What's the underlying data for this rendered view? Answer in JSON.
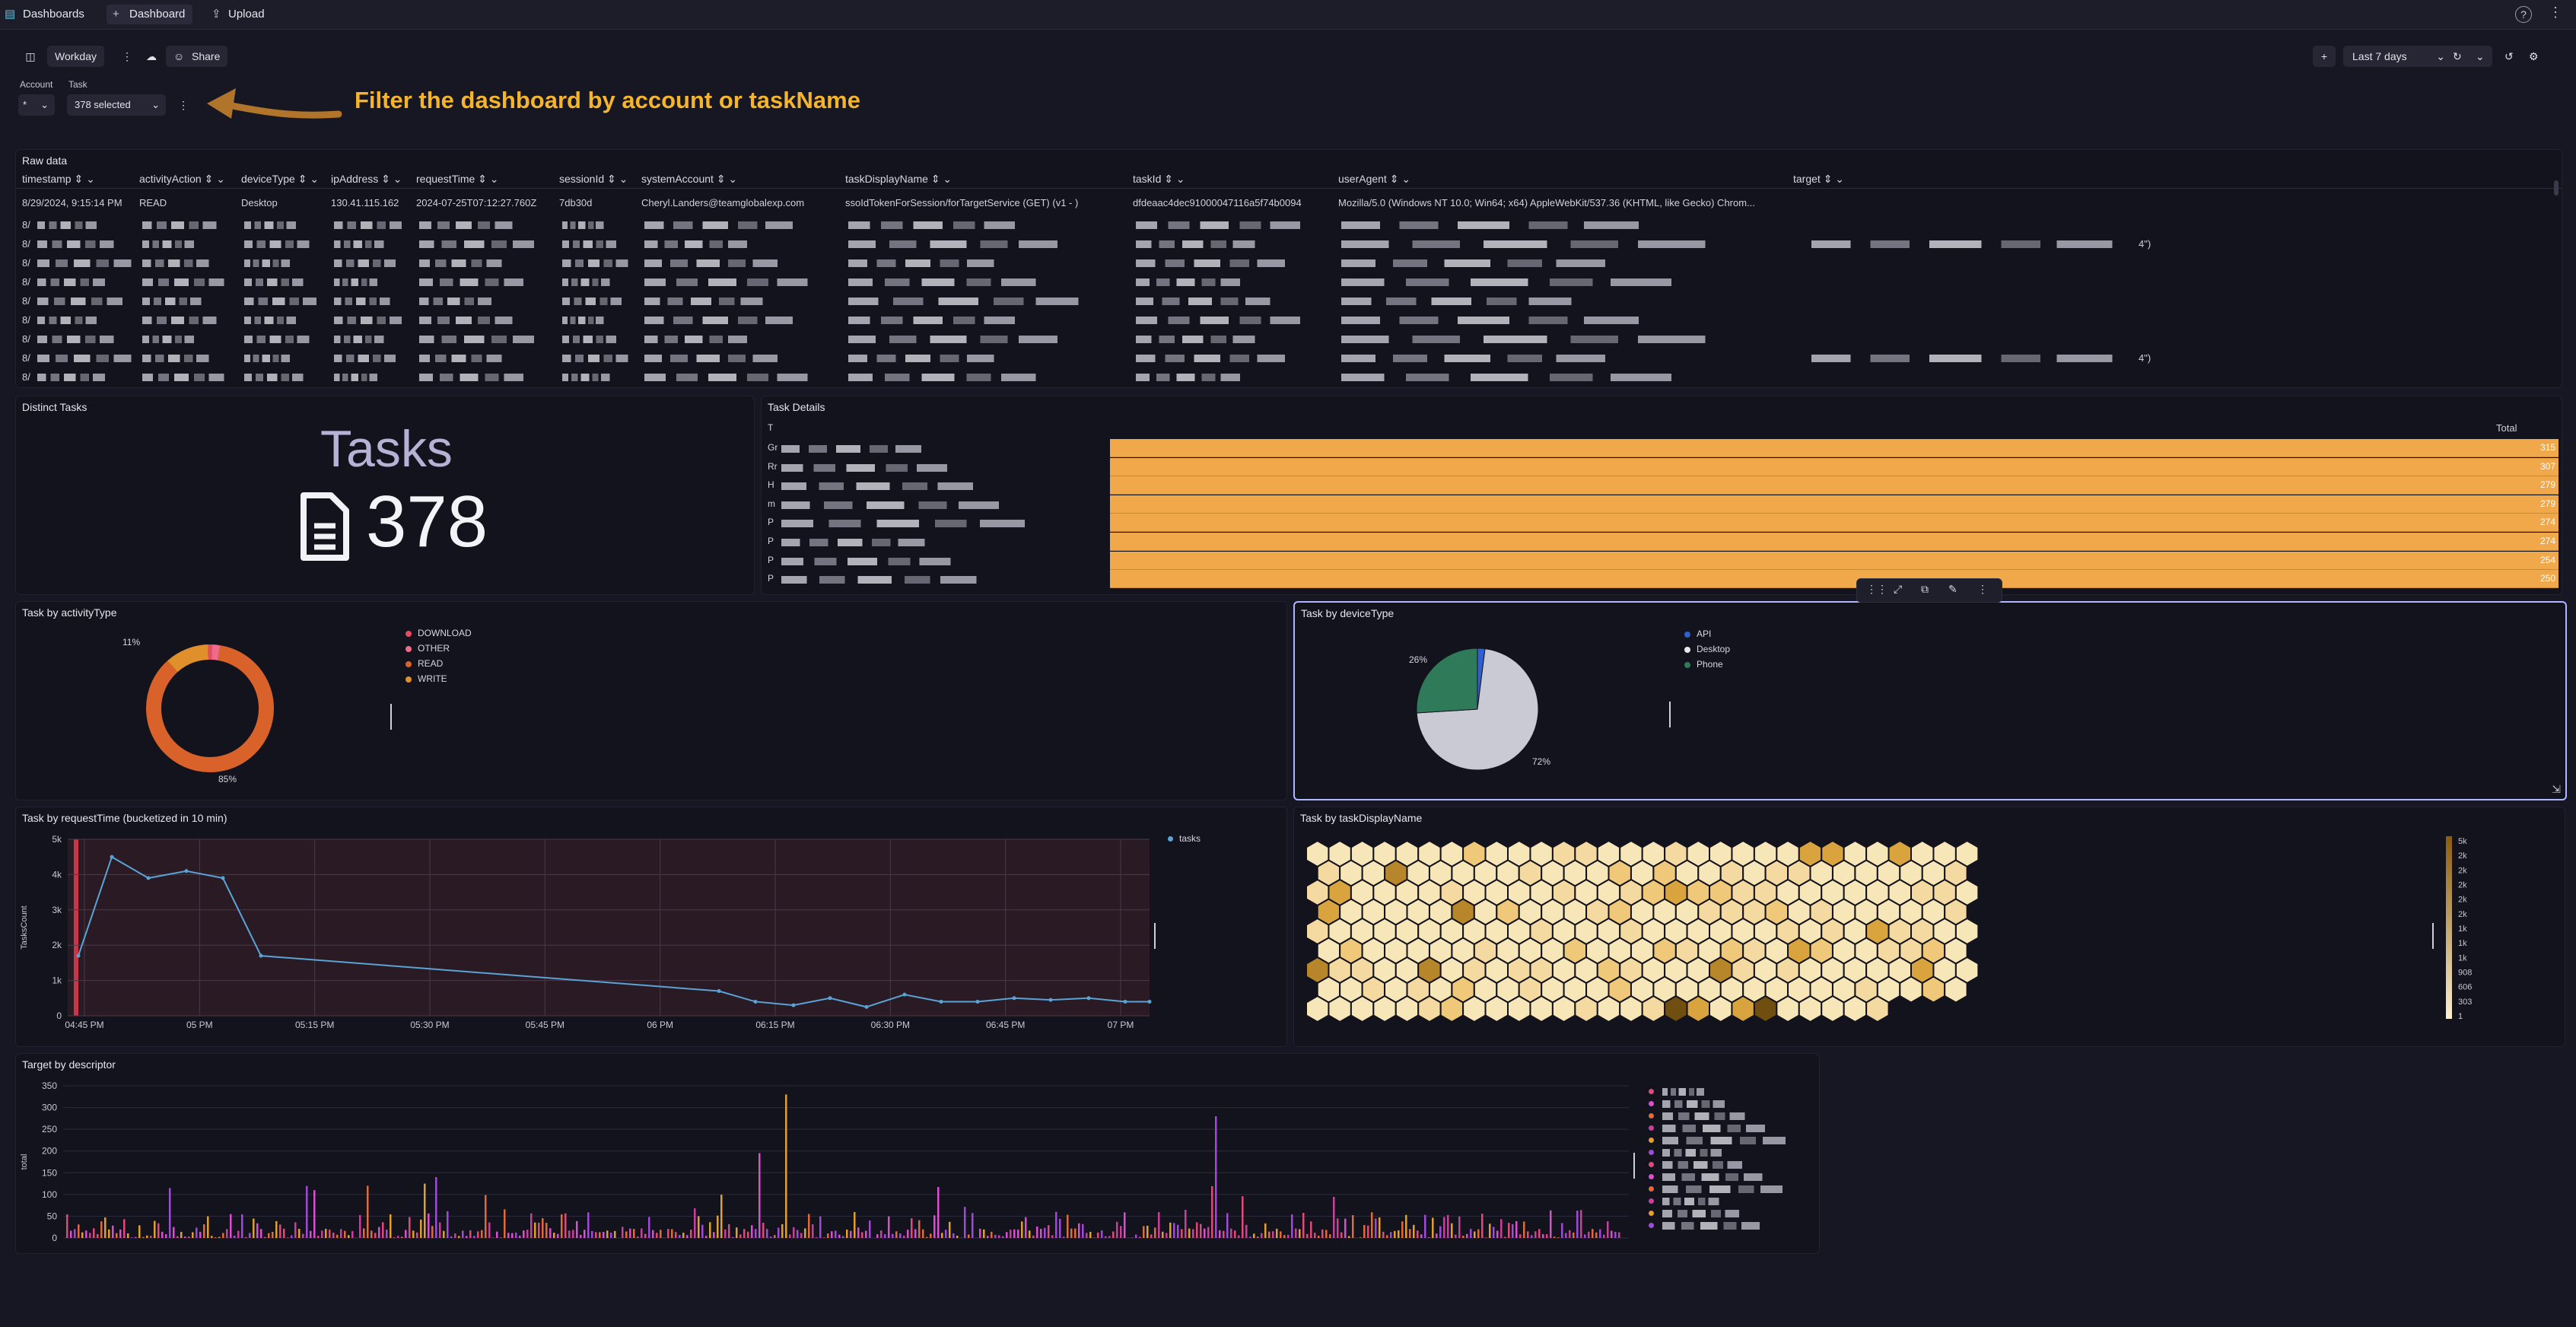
{
  "topbar": {
    "dashboards_label": "Dashboards",
    "dashboard_label": "Dashboard",
    "upload_label": "Upload",
    "icons": {
      "dashboards": "dashboards-icon",
      "dashboard": "plus-icon",
      "upload": "upload-icon",
      "help": "help-icon",
      "more": "more-vertical-icon"
    }
  },
  "header": {
    "dashboard_name": "Workday",
    "share_label": "Share",
    "time_range": "Last 7 days",
    "icons": {
      "sidebar": "sidebar-toggle-icon",
      "more": "more-vertical-icon",
      "cloud": "cloud-icon",
      "share": "users-icon",
      "add": "plus-icon",
      "refresh": "refresh-icon",
      "chevron": "chevron-down-icon",
      "history": "history-icon",
      "settings": "gear-icon"
    }
  },
  "filters": {
    "account_label": "Account",
    "task_label": "Task",
    "account_value": "*",
    "task_value": "378 selected"
  },
  "annotation": {
    "text": "Filter the dashboard by account or taskName",
    "color": "#f4b52c",
    "arrow_color": "#b0742a"
  },
  "raw_data": {
    "title": "Raw data",
    "columns": [
      "timestamp",
      "activityAction",
      "deviceType",
      "ipAddress",
      "requestTime",
      "sessionId",
      "systemAccount",
      "taskDisplayName",
      "taskId",
      "userAgent",
      "target"
    ],
    "first_row": [
      "8/29/2024, 9:15:14 PM",
      "READ",
      "Desktop",
      "130.41.115.162",
      "2024-07-25T07:12:27.760Z",
      "7db30d",
      "Cheryl.Landers@teamglobalexp.com",
      "ssoIdTokenForSession/forTargetService (GET) (v1 - )",
      "dfdeaac4dec91000047116a5f74b0094",
      "Mozilla/5.0 (Windows NT 10.0; Win64; x64) AppleWebKit/537.36 (KHTML, like Gecko) Chrom...",
      ""
    ],
    "row_prefix": "8/",
    "row_tail": "4\")"
  },
  "distinct_tasks": {
    "title": "Distinct Tasks",
    "label": "Tasks",
    "value": "378",
    "icon": "document-icon"
  },
  "task_details": {
    "title": "Task Details",
    "first_col_header": "T",
    "total_header": "Total",
    "row_prefixes": [
      "Gr",
      "Rr",
      "H",
      "m",
      "P",
      "P",
      "P",
      "P"
    ],
    "values": [
      315,
      307,
      279,
      279,
      274,
      274,
      254,
      250
    ],
    "bar_color": "#f0a84a"
  },
  "activity_type": {
    "title": "Task by activityType",
    "legend": [
      "DOWNLOAD",
      "OTHER",
      "READ",
      "WRITE"
    ],
    "colors": [
      "#e84a5f",
      "#f06a8a",
      "#d9622a",
      "#e0902a"
    ],
    "labels": [
      "11%",
      "85%"
    ]
  },
  "device_type": {
    "title": "Task by deviceType",
    "legend": [
      "API",
      "Desktop",
      "Phone"
    ],
    "colors": [
      "#2f5fd0",
      "#e8e8ee",
      "#2f7a58"
    ],
    "labels": [
      "26%",
      "72%"
    ],
    "toolbar_icons": [
      "drag-handle-icon",
      "expand-icon",
      "copy-icon",
      "edit-icon",
      "more-vertical-icon"
    ]
  },
  "request_time": {
    "title": "Task by requestTime (bucketized in 10 min)",
    "legend": "tasks",
    "ylabel": "TasksCount"
  },
  "task_display": {
    "title": "Task by taskDisplayName",
    "scale": [
      "5k",
      "2k",
      "2k",
      "2k",
      "2k",
      "2k",
      "1k",
      "1k",
      "1k",
      "908",
      "606",
      "303",
      "1"
    ]
  },
  "target_descriptor": {
    "title": "Target by descriptor",
    "ylabel": "total"
  },
  "chart_data": [
    {
      "type": "pie",
      "title": "Task by activityType",
      "labels": [
        "DOWNLOAD",
        "OTHER",
        "READ",
        "WRITE"
      ],
      "values": [
        1,
        2,
        85,
        11
      ]
    },
    {
      "type": "pie",
      "title": "Task by deviceType",
      "labels": [
        "API",
        "Desktop",
        "Phone"
      ],
      "values": [
        2,
        72,
        26
      ]
    },
    {
      "type": "line",
      "title": "Task by requestTime (bucketized in 10 min)",
      "ylabel": "TasksCount",
      "x": [
        "04:45 PM",
        "05 PM",
        "05:15 PM",
        "05:30 PM",
        "05:45 PM",
        "06 PM",
        "06:15 PM",
        "06:30 PM",
        "06:45 PM",
        "07 PM"
      ],
      "ylim": [
        0,
        5000
      ],
      "yticks": [
        "0",
        "1k",
        "2k",
        "3k",
        "4k",
        "5k"
      ],
      "series": [
        {
          "name": "tasks",
          "values": [
            1700,
            4500,
            3900,
            4100,
            3900,
            1700,
            700,
            400,
            300,
            500,
            250,
            600,
            400,
            400,
            500,
            450,
            500,
            400,
            400
          ]
        }
      ]
    },
    {
      "type": "bar",
      "title": "Target by descriptor",
      "ylabel": "total",
      "ylim": [
        0,
        350
      ],
      "yticks": [
        "0",
        "50",
        "100",
        "150",
        "200",
        "250",
        "300",
        "350"
      ],
      "peaks": [
        330,
        280,
        195,
        140,
        125,
        120,
        110
      ]
    },
    {
      "type": "heatmap",
      "title": "Task by taskDisplayName",
      "scale": [
        "5k",
        "2k",
        "2k",
        "2k",
        "2k",
        "2k",
        "1k",
        "1k",
        "1k",
        "908",
        "606",
        "303",
        "1"
      ]
    }
  ]
}
